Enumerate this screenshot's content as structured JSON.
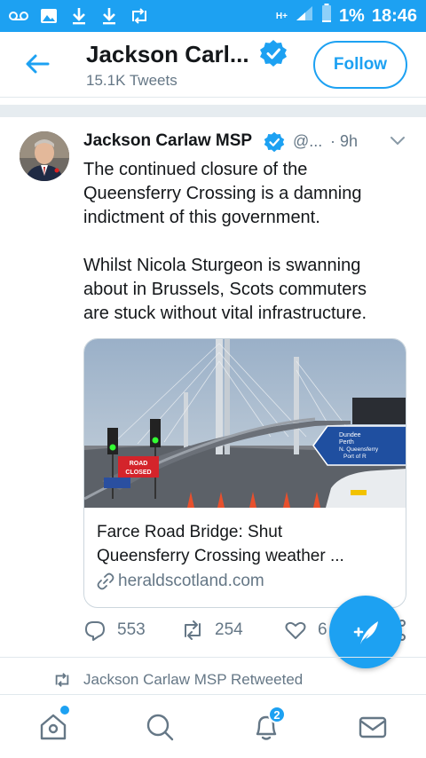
{
  "status_bar": {
    "network": "H+",
    "battery": "1%",
    "time": "18:46"
  },
  "header": {
    "name": "Jackson Carl...",
    "tweet_count": "15.1K Tweets",
    "follow_label": "Follow"
  },
  "tweet": {
    "author": "Jackson Carlaw MSP",
    "handle": "@...",
    "time": "· 9h",
    "text_line_1": "The continued closure of the",
    "text_line_2": "Queensferry Crossing is a damning",
    "text_line_3": "indictment of this government.",
    "text_line_4": "Whilst Nicola Sturgeon is swanning",
    "text_line_5": "about in Brussels, Scots commuters",
    "text_line_6": "are stuck without vital infrastructure.",
    "card": {
      "title_line_1": "Farce Road Bridge: Shut",
      "title_line_2": "Queensferry Crossing weather ...",
      "domain": "heraldscotland.com",
      "sign_road": "ROAD",
      "sign_closed": "CLOSED",
      "sign_dundee": "Dundee",
      "sign_perth": "Perth",
      "sign_nq": "N. Queensferry",
      "sign_port": "Port of R"
    },
    "replies": "553",
    "retweets": "254",
    "likes": "6"
  },
  "retweeted_label": "Jackson Carlaw MSP Retweeted",
  "bottom_nav": {
    "notifications_badge": "2"
  },
  "colors": {
    "accent": "#1da1f2",
    "secondary_text": "#657786"
  }
}
